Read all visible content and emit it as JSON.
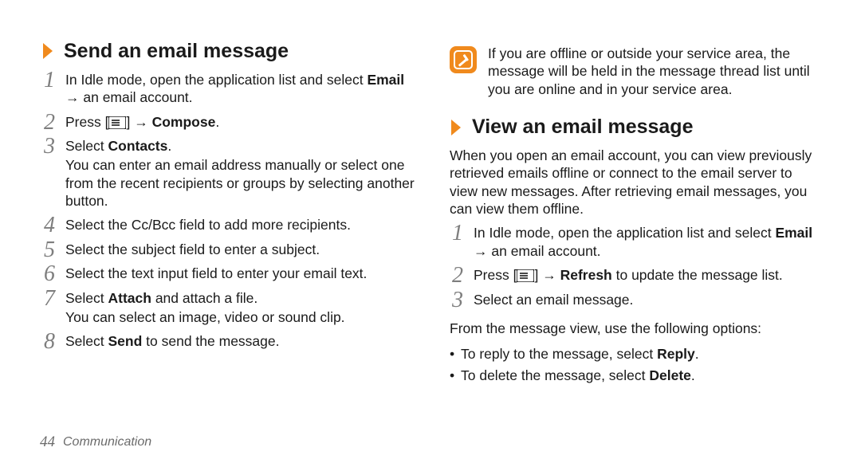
{
  "glyphs": {
    "arrow": "→"
  },
  "left": {
    "heading": "Send an email message",
    "steps": [
      {
        "n": "1",
        "parts": [
          "In Idle mode, open the application list and select ",
          {
            "b": "Email"
          },
          " ",
          {
            "arrow": true
          },
          " an email account."
        ]
      },
      {
        "n": "2",
        "parts": [
          "Press [",
          {
            "menu": true
          },
          "] ",
          {
            "arrow": true
          },
          " ",
          {
            "b": "Compose"
          },
          "."
        ]
      },
      {
        "n": "3",
        "parts": [
          "Select ",
          {
            "b": "Contacts"
          },
          "."
        ],
        "extra": "You can enter an email address manually or select one from the recent recipients or groups by selecting another button."
      },
      {
        "n": "4",
        "parts": [
          "Select the Cc/Bcc field to add more recipients."
        ]
      },
      {
        "n": "5",
        "parts": [
          "Select the subject field to enter a subject."
        ]
      },
      {
        "n": "6",
        "parts": [
          "Select the text input field to enter your email text."
        ]
      },
      {
        "n": "7",
        "parts": [
          "Select ",
          {
            "b": "Attach"
          },
          " and attach a file."
        ],
        "extra": "You can select an image, video or sound clip."
      },
      {
        "n": "8",
        "parts": [
          "Select ",
          {
            "b": "Send"
          },
          " to send the message."
        ]
      }
    ]
  },
  "right": {
    "note": "If you are offline or outside your service area, the message will be held in the message thread list until you are online and in your service area.",
    "heading": "View an email message",
    "intro": "When you open an email account, you can view previously retrieved emails offline or connect to the email server to view new messages. After retrieving email messages, you can view them offline.",
    "steps": [
      {
        "n": "1",
        "parts": [
          "In Idle mode, open the application list and select ",
          {
            "b": "Email"
          },
          " ",
          {
            "arrow": true
          },
          " an email account."
        ]
      },
      {
        "n": "2",
        "parts": [
          "Press [",
          {
            "menu": true
          },
          "] ",
          {
            "arrow": true
          },
          " ",
          {
            "b": "Refresh"
          },
          " to update the message list."
        ]
      },
      {
        "n": "3",
        "parts": [
          "Select an email message."
        ]
      }
    ],
    "options_lead": "From the message view, use the following options:",
    "bullets": [
      {
        "parts": [
          "To reply to the message, select ",
          {
            "b": "Reply"
          },
          "."
        ]
      },
      {
        "parts": [
          "To delete the message, select ",
          {
            "b": "Delete"
          },
          "."
        ]
      }
    ]
  },
  "footer": {
    "page": "44",
    "section": "Communication"
  }
}
